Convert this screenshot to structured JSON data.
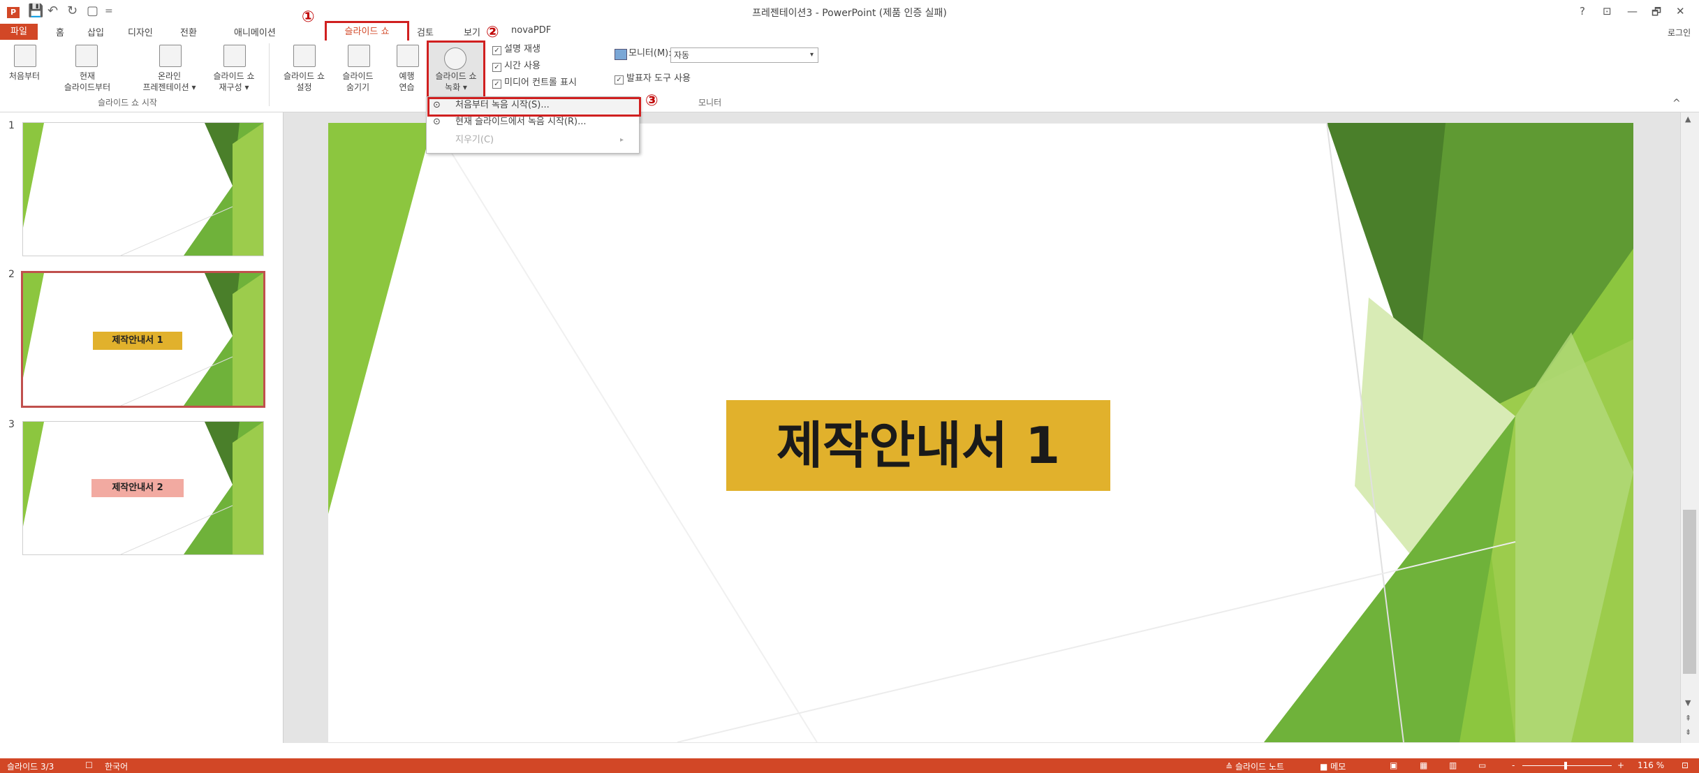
{
  "window": {
    "title": "프레젠테이션3 - PowerPoint (제품 인증 실패)",
    "help": "?",
    "controls": [
      "⊡",
      "—",
      "🗗",
      "✕"
    ],
    "signin": "로그인"
  },
  "quick_access": [
    "💾",
    "↶",
    "↻",
    "▢",
    "="
  ],
  "tabs": {
    "file": "파일",
    "items": [
      "홈",
      "삽입",
      "디자인",
      "전환",
      "애니메이션"
    ],
    "slideshow": "슬라이드 쇼",
    "review": "검토",
    "view": "보기",
    "novapdf": "novaPDF"
  },
  "callouts": [
    "①",
    "②",
    "③"
  ],
  "ribbon": {
    "group_start": {
      "label": "슬라이드 쇼 시작",
      "buttons": [
        {
          "line1": "처음부터",
          "line2": ""
        },
        {
          "line1": "현재",
          "line2": "슬라이드부터"
        },
        {
          "line1": "온라인",
          "line2": "프레젠테이션 ▾"
        },
        {
          "line1": "슬라이드 쇼",
          "line2": "재구성 ▾"
        }
      ]
    },
    "group_setup": {
      "buttons": [
        {
          "line1": "슬라이드 쇼",
          "line2": "설정"
        },
        {
          "line1": "슬라이드",
          "line2": "숨기기"
        },
        {
          "line1": "예행",
          "line2": "연습"
        },
        {
          "line1": "슬라이드 쇼",
          "line2": "녹화 ▾"
        }
      ],
      "checks": [
        "설명 재생",
        "시간 사용",
        "미디어 컨트롤 표시"
      ]
    },
    "group_monitor": {
      "label": "모니터",
      "monitor_label": "모니터(M):",
      "monitor_value": "자동",
      "presenter_check": "발표자 도구 사용"
    },
    "collapse": "^"
  },
  "dropdown": {
    "items": [
      "처음부터 녹음 시작(S)...",
      "현재 슬라이드에서 녹음 시작(R)...",
      "지우기(C)"
    ],
    "arrow": "▸"
  },
  "thumbnails": [
    {
      "num": "1",
      "title": ""
    },
    {
      "num": "2",
      "title": "제작안내서 1"
    },
    {
      "num": "3",
      "title": "제작안내서 2"
    }
  ],
  "slide": {
    "title": "제작안내서 1"
  },
  "statusbar": {
    "slide_count": "슬라이드 3/3",
    "language": "한국어",
    "notes": "≙ 슬라이드 노트",
    "comments": "■ 메모",
    "zoom_minus": "-",
    "zoom_plus": "+",
    "zoom_level": "116 %"
  },
  "colors": {
    "accent": "#d24726",
    "slide_title_bg": "#e1b12c",
    "thumb3_title_bg": "#f2aaa1",
    "highlight_red": "#d02020",
    "green_dark": "#4a7f2a",
    "green_mid": "#6fb23a",
    "green_light": "#9ccc4c"
  }
}
